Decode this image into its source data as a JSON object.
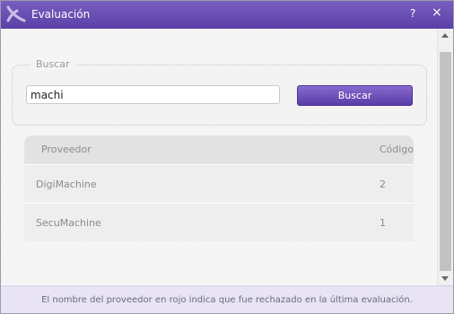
{
  "window": {
    "title": "Evaluación",
    "help_label": "?",
    "close_label": "×"
  },
  "search": {
    "legend": "Buscar",
    "value": "machi",
    "button_label": "Buscar"
  },
  "table": {
    "columns": [
      "Proveedor",
      "Código"
    ],
    "rows": [
      {
        "proveedor": "DigiMachine",
        "codigo": "2"
      },
      {
        "proveedor": "SecuMachine",
        "codigo": "1"
      }
    ]
  },
  "footer": {
    "note": "El nombre del proveedor en rojo indica que fue rechazado en la última evaluación."
  },
  "colors": {
    "title_bar": "#5b3fa6",
    "button": "#6a4bb8"
  }
}
